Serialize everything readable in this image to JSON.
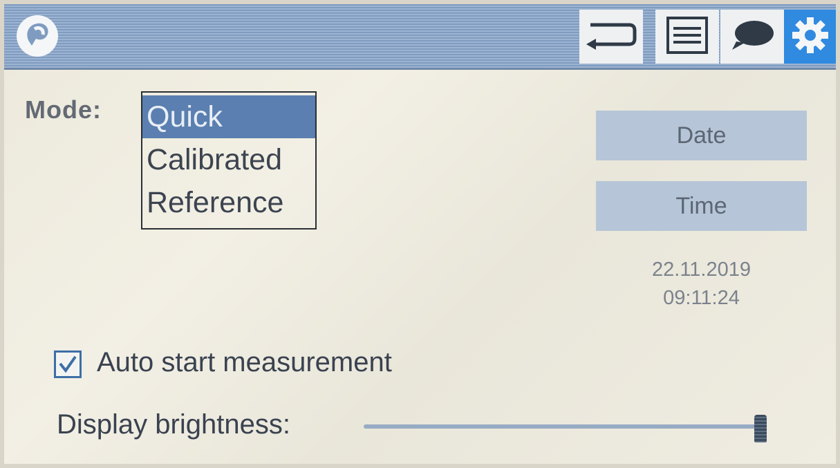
{
  "header": {
    "logo_icon": "speech-bubble-logo-icon",
    "buttons": [
      {
        "icon": "return-arrow-icon"
      },
      {
        "icon": "menu-list-icon"
      },
      {
        "icon": "chat-bubble-icon"
      },
      {
        "icon": "gear-icon",
        "active": true
      }
    ]
  },
  "mode": {
    "label": "Mode:",
    "options": [
      "Quick",
      "Calibrated",
      "Reference"
    ],
    "selected": "Quick"
  },
  "date_button": {
    "label": "Date"
  },
  "time_button": {
    "label": "Time"
  },
  "datetime": {
    "date": "22.11.2019",
    "time": "09:11:24"
  },
  "auto_start": {
    "label": "Auto start measurement",
    "checked": true
  },
  "brightness": {
    "label": "Display brightness:",
    "value_fraction": 0.99
  },
  "colors": {
    "accent": "#2f8ae0",
    "selection": "#5a7fb0",
    "header": "#8ea8c9"
  }
}
